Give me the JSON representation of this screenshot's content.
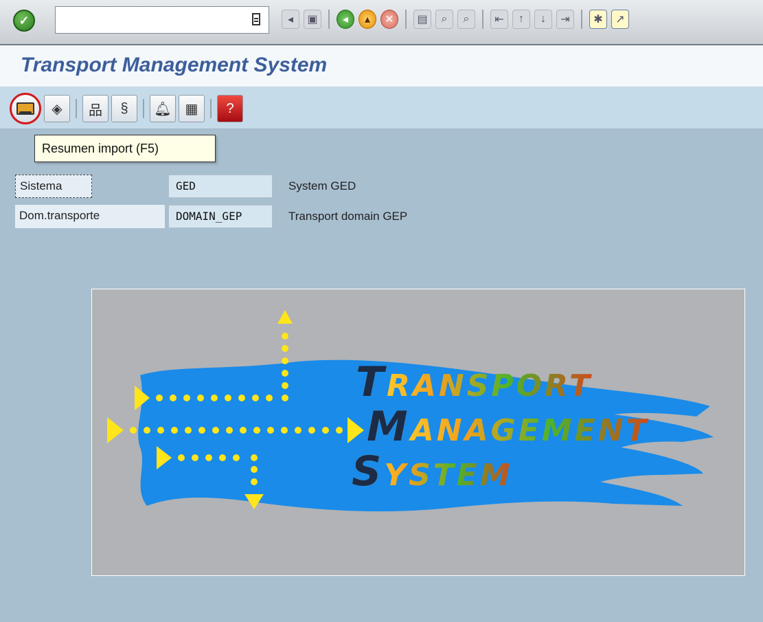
{
  "system_toolbar": {
    "command_field_value": "",
    "icons": [
      "back-icon",
      "save-icon",
      "green-back-icon",
      "exit-icon",
      "cancel-icon",
      "print-icon",
      "find-icon",
      "find-next-icon",
      "first-page-icon",
      "prev-page-icon",
      "next-page-icon",
      "last-page-icon",
      "new-session-icon",
      "shortcut-icon"
    ]
  },
  "title": "Transport Management System",
  "app_toolbar": {
    "tools": [
      "import-overview-icon",
      "import-monitor-icon",
      "system-overview-icon",
      "transport-routes-icon",
      "alert-monitor-icon",
      "tms-log-icon",
      "help-icon"
    ]
  },
  "tooltip": "Resumen import  (F5)",
  "fields": [
    {
      "label": "Sistema",
      "value": "GED",
      "description": "System GED"
    },
    {
      "label": "Dom.transporte",
      "value": "DOMAIN_GEP",
      "description": "Transport domain GEP"
    }
  ],
  "splash": {
    "line1_cap": "T",
    "line1_rest": "RANSPORT",
    "line2_cap": "M",
    "line2_rest": "ANAGEMENT",
    "line3_cap": "S",
    "line3_rest": "YSTEM"
  },
  "colors": {
    "background": "#a8bfd0",
    "title": "#3d5e9a",
    "app_toolbar": "#c6dbe9",
    "splash_blue": "#1a8be8",
    "arrow_yellow": "#ffe51a"
  }
}
